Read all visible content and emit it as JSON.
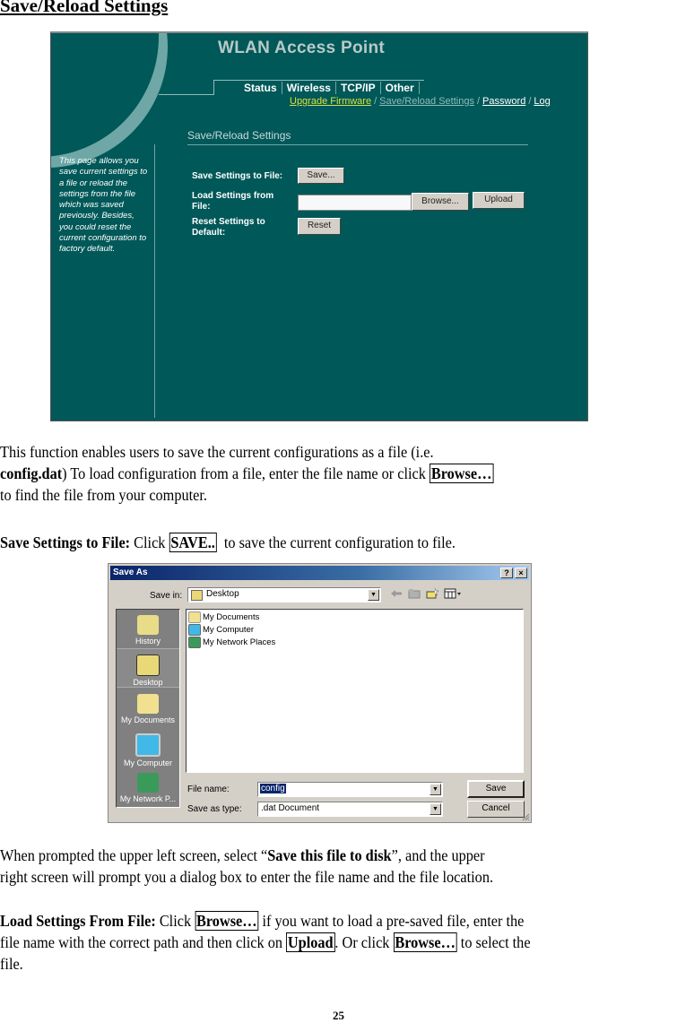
{
  "doc": {
    "title": "Save/Reload Settings",
    "page_number": "25"
  },
  "router_ui": {
    "app_title": "WLAN Access Point",
    "tabs": [
      "Status",
      "Wireless",
      "TCP/IP",
      "Other"
    ],
    "sublinks": [
      {
        "label": "Upgrade Firmware",
        "state": "link"
      },
      {
        "label": "Save/Reload Settings",
        "state": "current"
      },
      {
        "label": "Password",
        "state": "link"
      },
      {
        "label": "Log",
        "state": "link"
      }
    ],
    "section_title": "Save/Reload Settings",
    "help_text": "This page allows you save current settings to a file or reload the settings from the file which was saved previously. Besides, you could reset the current configuration to factory default.",
    "rows": [
      {
        "label": "Save Settings to File:",
        "button": "Save..."
      },
      {
        "label": "Load Settings from File:",
        "input_value": "",
        "browse_button": "Browse...",
        "upload_button": "Upload"
      },
      {
        "label": "Reset Settings to Default:",
        "button": "Reset"
      }
    ],
    "colors": {
      "background": "#015858",
      "link_highlight": "#d8e23c"
    }
  },
  "paragraphs": {
    "p1": {
      "text1": "This function enables users to save the current configurations as a file (i.e.",
      "bold1": "config.dat",
      "text2": ") To load configuration from a file, enter the file name or click ",
      "boxed1": "Browse…",
      "text3": "to find the file from your computer."
    },
    "p2": {
      "bold1": "Save Settings to File:",
      "text1": " Click ",
      "boxed1": "SAVE..",
      "text2": "  to save the current configuration to file."
    },
    "p3": {
      "text1": "When prompted the upper left screen, select “",
      "bold1": "Save this file to disk",
      "text2": "”, and the upper",
      "text3": "right screen will prompt you a dialog box to enter the file name and the file location."
    },
    "p4": {
      "bold1": "Load Settings From File:",
      "text1": " Click ",
      "boxed1": "Browse…",
      "text2": " if you want to load a pre-saved file, enter the",
      "text3": "file name with the correct path and then click on ",
      "boxed2": "Upload",
      "text4": ". Or click ",
      "boxed3": "Browse…",
      "text5": " to select the",
      "text6": "file."
    }
  },
  "save_dialog": {
    "title": "Save As",
    "help_button": "?",
    "close_button": "×",
    "save_in_label": "Save in:",
    "save_in_value": "Desktop",
    "places": [
      "History",
      "Desktop",
      "My Documents",
      "My Computer",
      "My Network P..."
    ],
    "files": [
      "My Documents",
      "My Computer",
      "My Network Places"
    ],
    "file_name_label": "File name:",
    "file_name_value": "config",
    "save_as_type_label": "Save as type:",
    "save_as_type_value": ".dat Document",
    "save_button": "Save",
    "cancel_button": "Cancel"
  }
}
